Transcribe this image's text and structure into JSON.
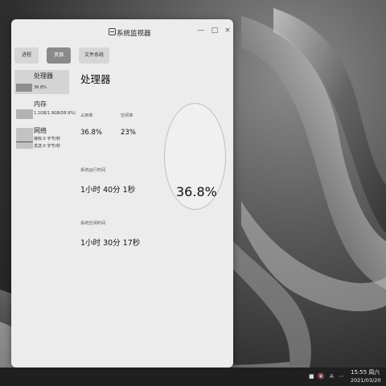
{
  "window": {
    "title": "系统监视器",
    "minimize_glyph": "—",
    "maximize_glyph": "□",
    "close_glyph": "×"
  },
  "tabs": [
    {
      "label": "进程",
      "active": false
    },
    {
      "label": "资源",
      "active": true
    },
    {
      "label": "文件系统",
      "active": false
    }
  ],
  "sidebar": {
    "items": [
      {
        "title": "处理器",
        "sub": "36.8%"
      },
      {
        "title": "内存",
        "sub": "1.1GB/1.9GB(58.9%)"
      },
      {
        "title": "网络",
        "sub_recv": "接收:0 字节/秒",
        "sub_send": "发送:0 字节/秒"
      }
    ]
  },
  "main": {
    "title": "处理器",
    "usage_label": "占用率",
    "usage_value": "36.8%",
    "idle_label": "空闲率",
    "idle_value": "23%",
    "uptime_label": "系统运行时间",
    "uptime_value": "1小时 40分 1秒",
    "idletime_label": "系统空闲时间",
    "idletime_value": "1小时 30分 17秒",
    "gauge_value": "36.8%"
  },
  "taskbar": {
    "tray": [
      "■",
      "🔇",
      "A",
      "⋯"
    ],
    "time": "15:55 周六",
    "date": "2021/03/20"
  }
}
